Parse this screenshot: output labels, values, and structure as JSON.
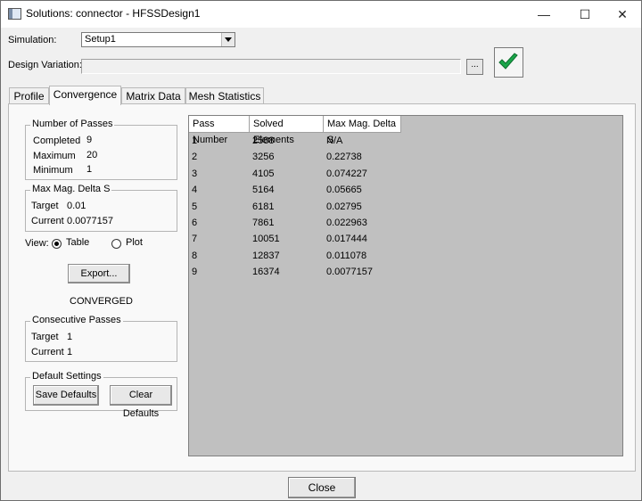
{
  "window": {
    "title": "Solutions: connector - HFSSDesign1",
    "minimize_glyph": "—",
    "maximize_glyph": "☐",
    "close_glyph": "✕"
  },
  "simulation": {
    "label": "Simulation:",
    "selected": "Setup1"
  },
  "design_variation": {
    "label": "Design Variation:",
    "value": "",
    "browse_label": "..."
  },
  "status_check_color": "#1aa64a",
  "tabs": [
    {
      "label": "Profile",
      "active": false
    },
    {
      "label": "Convergence",
      "active": true
    },
    {
      "label": "Matrix Data",
      "active": false
    },
    {
      "label": "Mesh Statistics",
      "active": false
    }
  ],
  "number_of_passes": {
    "title": "Number of Passes",
    "completed_label": "Completed",
    "completed": "9",
    "maximum_label": "Maximum",
    "maximum": "20",
    "minimum_label": "Minimum",
    "minimum": "1"
  },
  "max_mag_delta_s": {
    "title": "Max Mag. Delta S",
    "target_label": "Target",
    "target": "0.01",
    "current_label": "Current",
    "current": "0.0077157"
  },
  "view": {
    "label": "View:",
    "table_label": "Table",
    "plot_label": "Plot",
    "selected": "Table"
  },
  "export_label": "Export...",
  "status_text": "CONVERGED",
  "consecutive_passes": {
    "title": "Consecutive Passes",
    "target_label": "Target",
    "target": "1",
    "current_label": "Current",
    "current": "1"
  },
  "default_settings": {
    "title": "Default Settings",
    "save_label": "Save Defaults",
    "clear_label": "Clear Defaults"
  },
  "table": {
    "headers": [
      "Pass Number",
      "Solved Elements",
      "Max Mag. Delta S"
    ],
    "rows": [
      [
        "1",
        "2588",
        "N/A"
      ],
      [
        "2",
        "3256",
        "0.22738"
      ],
      [
        "3",
        "4105",
        "0.074227"
      ],
      [
        "4",
        "5164",
        "0.05665"
      ],
      [
        "5",
        "6181",
        "0.02795"
      ],
      [
        "6",
        "7861",
        "0.022963"
      ],
      [
        "7",
        "10051",
        "0.017444"
      ],
      [
        "8",
        "12837",
        "0.011078"
      ],
      [
        "9",
        "16374",
        "0.0077157"
      ]
    ]
  },
  "close_label": "Close"
}
